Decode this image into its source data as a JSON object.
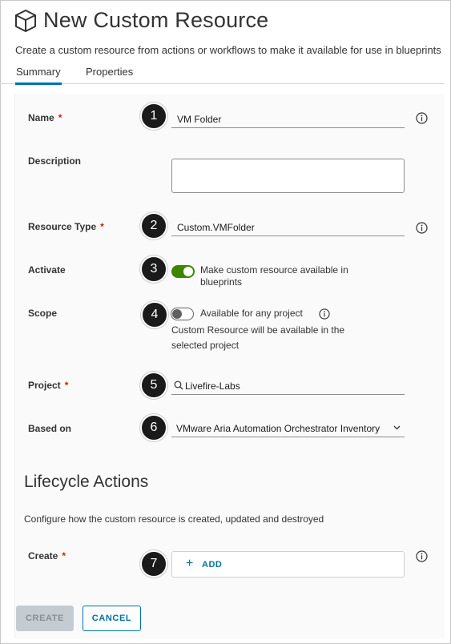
{
  "page": {
    "title": "New Custom Resource",
    "subtitle": "Create a custom resource from actions or workflows to make it available for use in blueprints"
  },
  "tabs": [
    {
      "label": "Summary",
      "active": true
    },
    {
      "label": "Properties",
      "active": false
    }
  ],
  "form": {
    "name": {
      "label": "Name",
      "required": "*",
      "value": "VM Folder"
    },
    "description": {
      "label": "Description",
      "value": ""
    },
    "resource_type": {
      "label": "Resource Type",
      "required": "*",
      "value": "Custom.VMFolder"
    },
    "activate": {
      "label": "Activate",
      "toggle_on": true,
      "toggle_text_line1": "Make custom resource available in",
      "toggle_text_line2": "blueprints"
    },
    "scope": {
      "label": "Scope",
      "toggle_on": false,
      "toggle_text": "Available for any project",
      "helper_line1": "Custom Resource will be available in the",
      "helper_line2": "selected project"
    },
    "project": {
      "label": "Project",
      "required": "*",
      "value": "Livefire-Labs"
    },
    "based_on": {
      "label": "Based on",
      "value": "VMware Aria Automation Orchestrator Inventory"
    }
  },
  "lifecycle": {
    "title": "Lifecycle Actions",
    "description": "Configure how the custom resource is created, updated and destroyed",
    "create": {
      "label": "Create",
      "required": "*",
      "add_label": "ADD"
    }
  },
  "buttons": {
    "create": "CREATE",
    "cancel": "CANCEL"
  },
  "callouts": [
    "1",
    "2",
    "3",
    "4",
    "5",
    "6",
    "7"
  ],
  "colors": {
    "accent": "#0072a3",
    "toggle_on": "#3c8500",
    "required": "#c92100",
    "callout": "#1a1a1a",
    "disabled_button": "#c4ccd1"
  },
  "icons": {
    "header": "cube-icon",
    "info": "info-circle-icon",
    "search": "search-icon",
    "chevron": "chevron-down-icon",
    "add": "plus-icon"
  }
}
